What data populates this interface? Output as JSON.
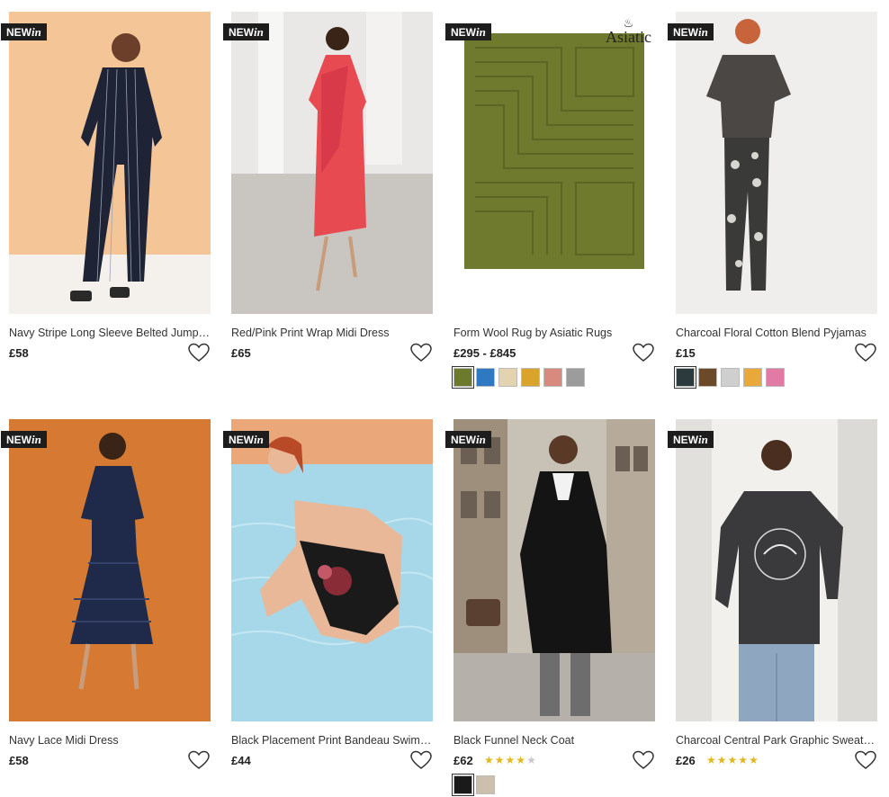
{
  "badge": {
    "new": "NEW",
    "in": "in"
  },
  "products": [
    {
      "title": "Navy Stripe Long Sleeve Belted Jumps...",
      "price": "£58"
    },
    {
      "title": "Red/Pink Print Wrap Midi Dress",
      "price": "£65"
    },
    {
      "title": "Form Wool Rug by Asiatic Rugs",
      "price": "£295 - £845",
      "brand_logo": "Asiatic",
      "swatch_colors": [
        "#6b7a2c",
        "#2f78c2",
        "#e3d3b0",
        "#d9a32c",
        "#d98a7e",
        "#9c9c9c"
      ]
    },
    {
      "title": "Charcoal Floral Cotton Blend Pyjamas",
      "price": "£15",
      "swatch_colors": [
        "#2c3a3e",
        "#6b4a2a",
        "#cfcfcf",
        "#e9a83a",
        "#e27aa6"
      ]
    },
    {
      "title": "Navy Lace Midi Dress",
      "price": "£58"
    },
    {
      "title": "Black Placement Print Bandeau Swims...",
      "price": "£44"
    },
    {
      "title": "Black Funnel Neck Coat",
      "price": "£62",
      "rating": 4,
      "swatch_colors": [
        "#1a1a1a",
        "#cdbfae"
      ]
    },
    {
      "title": "Charcoal Central Park Graphic Sweats...",
      "price": "£26",
      "rating": 5
    }
  ],
  "colors": {
    "star_on": "#e2b81d",
    "star_off": "#c8c8c8",
    "badge_bg": "#1d1d1d"
  }
}
